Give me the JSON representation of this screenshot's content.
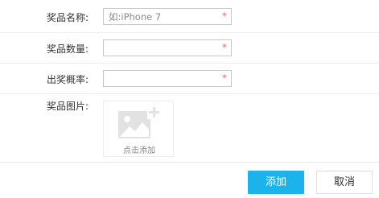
{
  "form": {
    "prize_name": {
      "label": "奖品名称:",
      "placeholder": "如:iPhone 7",
      "value": "",
      "required_mark": "*"
    },
    "prize_quantity": {
      "label": "奖品数量:",
      "placeholder": "",
      "value": "",
      "required_mark": "*"
    },
    "win_rate": {
      "label": "出奖概率:",
      "placeholder": "",
      "value": "",
      "required_mark": "*"
    },
    "prize_image": {
      "label": "奖品图片:",
      "upload_text": "点击添加"
    }
  },
  "actions": {
    "add_label": "添加",
    "cancel_label": "取消"
  },
  "colors": {
    "primary": "#1ab3ec",
    "required": "#f06060",
    "border": "#c9c9c9"
  },
  "icons": {
    "upload": "image-add-icon"
  }
}
